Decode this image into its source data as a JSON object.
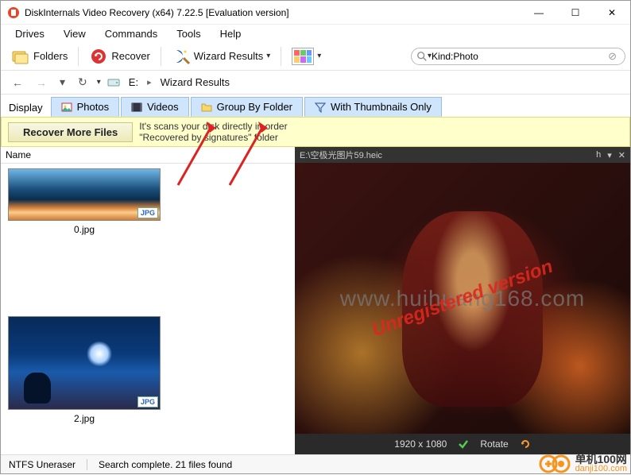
{
  "window": {
    "title": "DiskInternals Video Recovery (x64) 7.22.5 [Evaluation version]",
    "minimize": "—",
    "maximize": "☐",
    "close": "✕"
  },
  "menu": {
    "drives": "Drives",
    "view": "View",
    "commands": "Commands",
    "tools": "Tools",
    "help": "Help"
  },
  "toolbar": {
    "folders": "Folders",
    "recover": "Recover",
    "wizard_results": "Wizard Results"
  },
  "search": {
    "placeholder": "",
    "value": "Kind:Photo"
  },
  "breadcrumb": {
    "drive": "E:",
    "wizard": "Wizard Results"
  },
  "filters": {
    "display": "Display",
    "photos": "Photos",
    "videos": "Videos",
    "group_by_folder": "Group By Folder",
    "with_thumbnails": "With Thumbnails Only"
  },
  "hint": {
    "button": "Recover More Files",
    "line1": "It's scans your disk directly in order",
    "line2": "\"Recovered by signatures\" folder"
  },
  "list": {
    "header": "Name",
    "items": [
      {
        "name": "0.jpg",
        "badge": "JPG"
      },
      {
        "name": "2.jpg",
        "badge": "JPG"
      }
    ]
  },
  "preview": {
    "path": "E:\\空极光图片59.heic",
    "h": "h",
    "dims": "1920 x 1080",
    "rotate": "Rotate",
    "watermark_url": "www.huihuang168.com",
    "watermark_unreg": "Unregistered version"
  },
  "status": {
    "left": "NTFS Uneraser",
    "right": "Search complete. 21 files found"
  },
  "brand": {
    "name": "单机100网",
    "url": "danji100.com"
  }
}
